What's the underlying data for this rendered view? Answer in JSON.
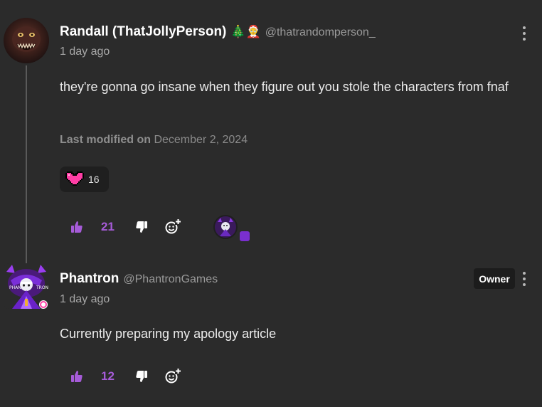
{
  "comments": [
    {
      "author_name": "Randall (ThatJollyPerson)",
      "author_emojis": "🎄🤶",
      "handle": "@thatrandomperson_",
      "time": "1 day ago",
      "text": "they're gonna go insane when they figure out you stole the characters from fnaf",
      "modified_label": "Last modified on",
      "modified_date": "December 2, 2024",
      "reaction_count": "16",
      "upvotes": "21"
    },
    {
      "author_name": "Phantron",
      "handle": "@PhantronGames",
      "badge": "Owner",
      "time": "1 day ago",
      "text": "Currently preparing my apology article",
      "upvotes": "12"
    }
  ],
  "colors": {
    "background": "#2b2b2b",
    "accent": "#a65bd8",
    "reaction_heart": "#ff3ea5"
  },
  "icons": [
    "kebab-menu-icon",
    "thumbs-up-icon",
    "thumbs-down-icon",
    "add-reaction-icon",
    "pixel-heart-icon"
  ]
}
